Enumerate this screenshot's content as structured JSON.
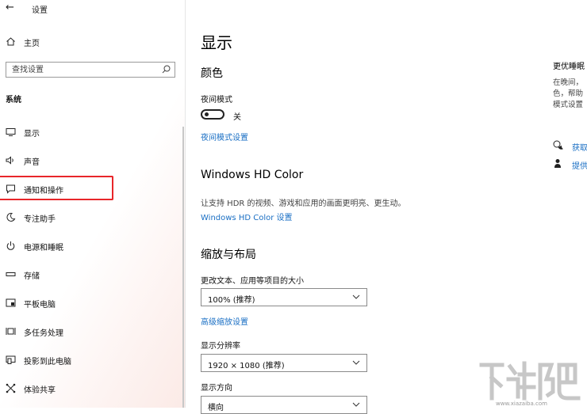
{
  "window": {
    "title": "设置",
    "back_glyph": "←"
  },
  "sidebar": {
    "home": "主页",
    "search_placeholder": "查找设置",
    "section": "系统",
    "items": [
      {
        "label": "显示",
        "icon": "monitor-icon"
      },
      {
        "label": "声音",
        "icon": "speaker-icon"
      },
      {
        "label": "通知和操作",
        "icon": "notification-icon"
      },
      {
        "label": "专注助手",
        "icon": "moon-icon"
      },
      {
        "label": "电源和睡眠",
        "icon": "power-icon"
      },
      {
        "label": "存储",
        "icon": "storage-icon"
      },
      {
        "label": "平板电脑",
        "icon": "tablet-icon"
      },
      {
        "label": "多任务处理",
        "icon": "multitask-icon"
      },
      {
        "label": "投影到此电脑",
        "icon": "project-icon"
      },
      {
        "label": "体验共享",
        "icon": "share-icon"
      }
    ],
    "highlight_color": "#e8262a"
  },
  "main": {
    "title": "显示",
    "color": {
      "heading": "颜色",
      "night_mode_label": "夜间模式",
      "night_mode_state": "关",
      "night_mode_link": "夜间模式设置"
    },
    "hdr": {
      "heading": "Windows HD Color",
      "description": "让支持 HDR 的视频、游戏和应用的画面更明亮、更生动。",
      "link": "Windows HD Color 设置"
    },
    "layout": {
      "heading": "缩放与布局",
      "scale_label": "更改文本、应用等项目的大小",
      "scale_value": "100% (推荐)",
      "advanced_link": "高级缩放设置",
      "resolution_label": "显示分辨率",
      "resolution_value": "1920 × 1080 (推荐)",
      "orientation_label": "显示方向",
      "orientation_value": "横向"
    }
  },
  "right_panel": {
    "title": "更优睡眠",
    "lines": [
      "在晚间，",
      "色，帮助",
      "模式设置"
    ],
    "links": [
      {
        "label": "获取",
        "icon": "help-chat-icon"
      },
      {
        "label": "提供",
        "icon": "feedback-icon"
      }
    ]
  },
  "watermark": {
    "url": "www.xiazaiba.com"
  },
  "colors": {
    "link": "#1a6fc4",
    "accent_red": "#e8262a"
  }
}
